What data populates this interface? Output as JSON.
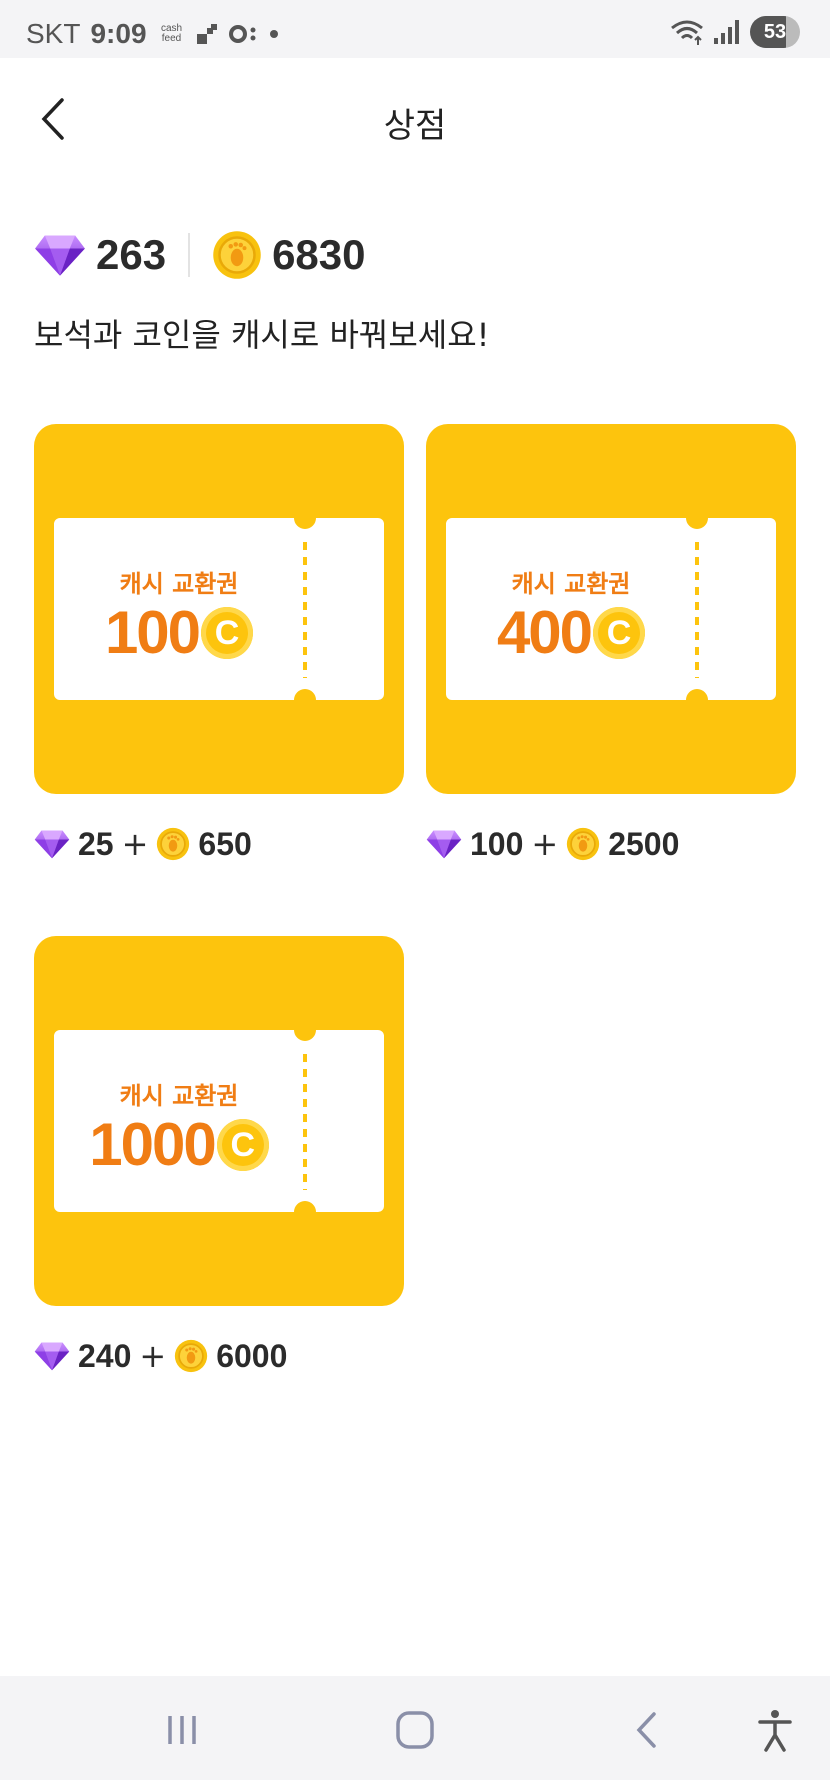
{
  "status_bar": {
    "carrier": "SKT",
    "time": "9:09",
    "cashfeed_label": "cash feed",
    "battery": "53"
  },
  "header": {
    "title": "상점"
  },
  "balance": {
    "gems": "263",
    "coins": "6830"
  },
  "subtitle": "보석과 코인을 캐시로 바꿔보세요!",
  "products": [
    {
      "ticket_title": "캐시 교환권",
      "amount": "100",
      "coin_symbol": "C",
      "gem_price": "25",
      "plus": "+",
      "coin_price": "650"
    },
    {
      "ticket_title": "캐시 교환권",
      "amount": "400",
      "coin_symbol": "C",
      "gem_price": "100",
      "plus": "+",
      "coin_price": "2500"
    },
    {
      "ticket_title": "캐시 교환권",
      "amount": "1000",
      "coin_symbol": "C",
      "gem_price": "240",
      "plus": "+",
      "coin_price": "6000"
    }
  ],
  "colors": {
    "card": "#fdc40d",
    "ticket_text": "#f07d14",
    "gem": "#9b4de0",
    "coin": "#f8c20f"
  },
  "icons": {
    "gem": "gem-icon",
    "coin": "coin-icon",
    "back": "back-chevron-icon",
    "nav_recents": "recents-icon",
    "nav_home": "home-icon",
    "nav_back": "nav-back-icon",
    "nav_accessibility": "accessibility-icon"
  }
}
